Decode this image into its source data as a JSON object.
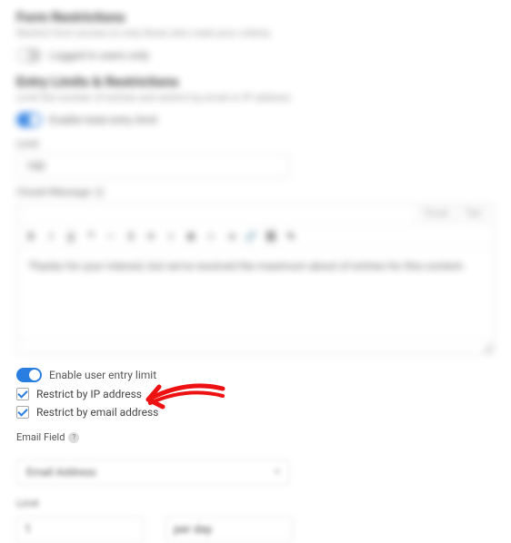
{
  "formRestrictions": {
    "title": "Form Restrictions",
    "desc": "Restrict form access to only those who meet your criteria.",
    "loggedInLabel": "Logged in users only"
  },
  "entryLimits": {
    "title": "Entry Limits & Restrictions",
    "desc": "Limit the number of entries and restrict by email or IP address.",
    "enableTotalLabel": "Enable total entry limit",
    "limitLabel": "Limit",
    "limitValue": "100",
    "closedMsgLabel": "Closed Message",
    "closedMsgBody": "Thanks for your interest, but we've received the maximum about of entries for this content.",
    "tabVisual": "Visual",
    "tabText": "Text"
  },
  "userEntry": {
    "enableLabel": "Enable user entry limit",
    "restrictIpLabel": "Restrict by IP address",
    "restrictEmailLabel": "Restrict by email address"
  },
  "emailField": {
    "label": "Email Field",
    "value": "Email Address"
  },
  "bottom": {
    "limitLabel": "Limit",
    "limitValue": "1",
    "perLabel": "per day"
  }
}
